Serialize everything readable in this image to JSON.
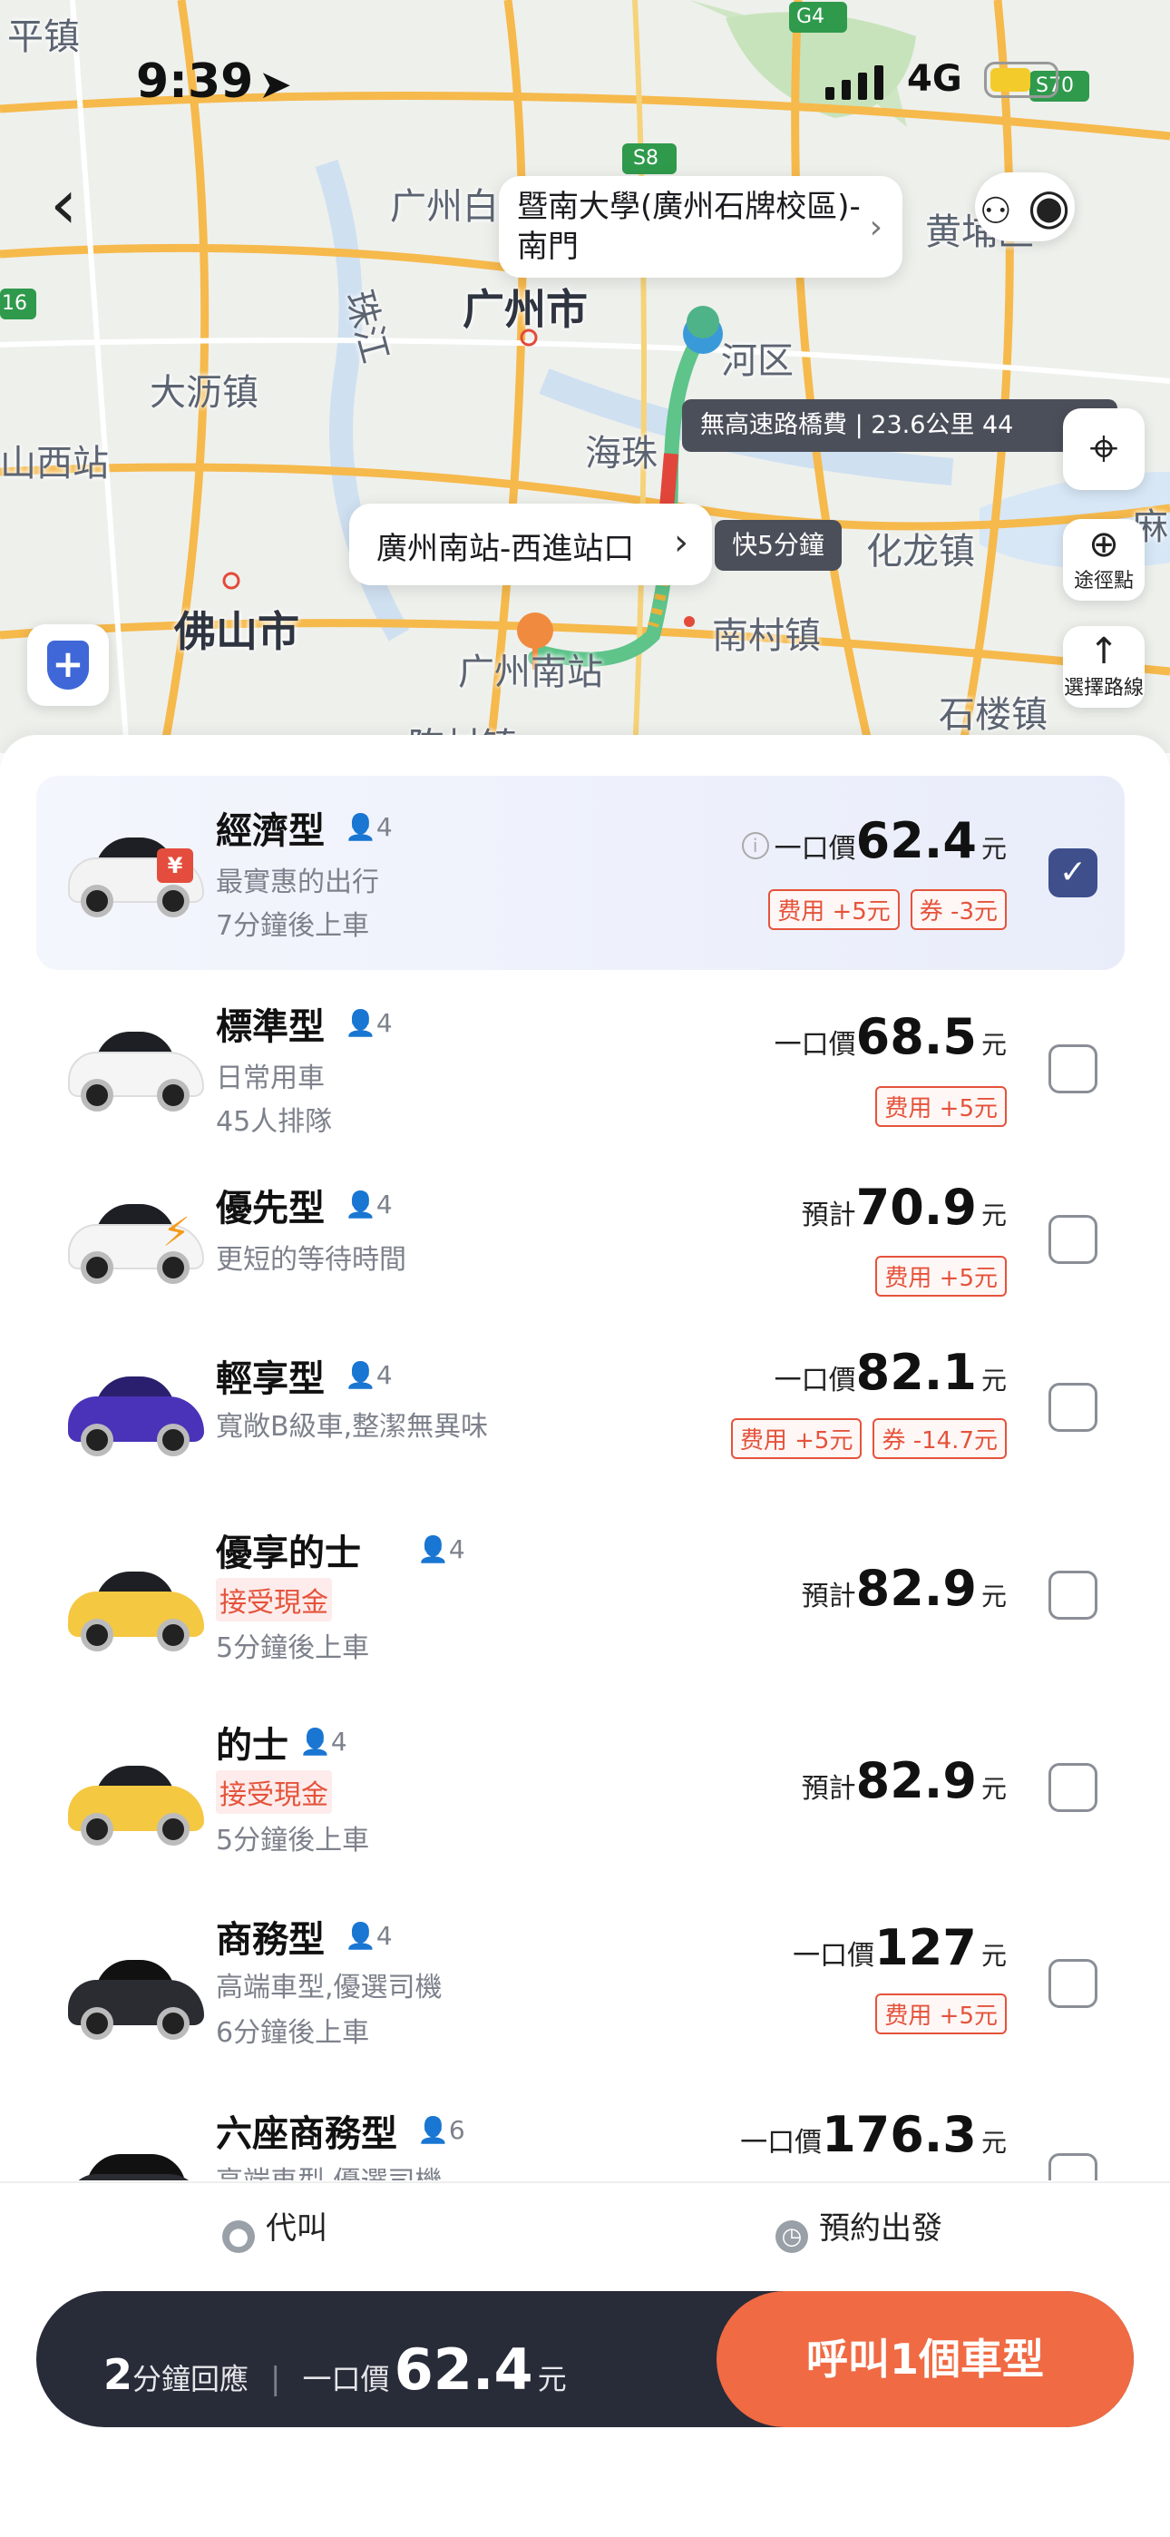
{
  "status_bar": {
    "time": "9:39",
    "network": "4G"
  },
  "map": {
    "labels": {
      "pingzhen": "平镇",
      "guangzhou_baiyun": "广州白",
      "guangzhou_city": "广州市",
      "zhujiang": "珠江",
      "dalijing": "大沥镇",
      "shanxizhan": "山西站",
      "foshan": "佛山市",
      "haizhu": "海珠",
      "hequ": "河区",
      "huanglong": "化龙镇",
      "nancun": "南村镇",
      "shilou": "石楼镇",
      "huangpu": "黄埔区",
      "guangzhou_south_label": "广州南站",
      "chencun": "陈村镇",
      "ma": "麻"
    },
    "road_shields": [
      "G4",
      "S8",
      "S70",
      "16"
    ],
    "destination": "暨南大學(廣州石牌校區)-南門",
    "origin": "廣州南站-西進站口",
    "faster_hint": "快5分鐘",
    "toll_info": "無高速路橋費 | 23.6公里 44",
    "waypoint_label": "途徑點",
    "route_label": "選擇路線"
  },
  "rides": [
    {
      "name": "經濟型",
      "pax": "4",
      "line1": "最實惠的出行",
      "line2": "7分鐘後上車",
      "price_label": "一口價",
      "price": "62.4",
      "unit": "元",
      "tags": [
        "费用 +5元",
        "券 -3元"
      ],
      "selected": true
    },
    {
      "name": "標準型",
      "pax": "4",
      "line1": "日常用車",
      "line2": "45人排隊",
      "price_label": "一口價",
      "price": "68.5",
      "unit": "元",
      "tags": [
        "费用 +5元"
      ],
      "selected": false
    },
    {
      "name": "優先型",
      "pax": "4",
      "line1": "更短的等待時間",
      "line2": "",
      "price_label": "預計",
      "price": "70.9",
      "unit": "元",
      "tags": [
        "费用 +5元"
      ],
      "selected": false
    },
    {
      "name": "輕享型",
      "pax": "4",
      "line1": "寬敞B級車,整潔無異味",
      "line2": "",
      "price_label": "一口價",
      "price": "82.1",
      "unit": "元",
      "tags": [
        "费用 +5元",
        "券 -14.7元"
      ],
      "selected": false
    },
    {
      "name": "優享的士",
      "pax": "4",
      "line1": "接受現金",
      "line2": "5分鐘後上車",
      "price_label": "預計",
      "price": "82.9",
      "unit": "元",
      "tags": [],
      "selected": false
    },
    {
      "name": "的士",
      "pax": "4",
      "line1": "接受現金",
      "line2": "5分鐘後上車",
      "price_label": "預計",
      "price": "82.9",
      "unit": "元",
      "tags": [],
      "selected": false
    },
    {
      "name": "商務型",
      "pax": "4",
      "line1": "高端車型,優選司機",
      "line2": "6分鐘後上車",
      "price_label": "一口價",
      "price": "127",
      "unit": "元",
      "tags": [
        "费用 +5元"
      ],
      "selected": false
    },
    {
      "name": "六座商務型",
      "pax": "6",
      "line1": "高端車型,優選司機",
      "line2": "",
      "price_label": "一口價",
      "price": "176.3",
      "unit": "元",
      "tags": [],
      "selected": false
    }
  ],
  "options": {
    "proxy_call": "代叫",
    "schedule": "預約出發"
  },
  "cta": {
    "minutes": "2",
    "minutes_suffix": "分鐘回應",
    "price_label": "一口價",
    "price": "62.4",
    "unit": "元",
    "call_label": "呼叫1個車型"
  },
  "colors": {
    "accent": "#f06a43",
    "selected_check": "#3e4f8c",
    "tag_red": "#e5533b",
    "cta_dark": "#282b38",
    "route_green": "#5ec48a"
  }
}
